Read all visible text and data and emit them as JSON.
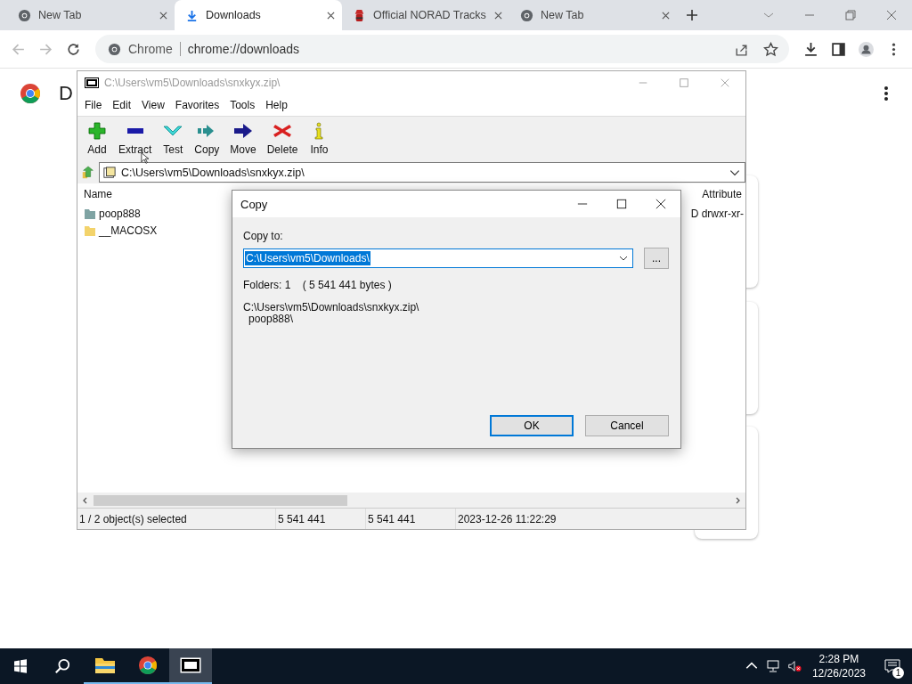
{
  "browser": {
    "tabs": [
      {
        "title": "New Tab",
        "kind": "chrome",
        "selected": false
      },
      {
        "title": "Downloads",
        "kind": "download",
        "selected": true
      },
      {
        "title": "Official NORAD Tracks",
        "kind": "figure",
        "selected": false
      },
      {
        "title": "New Tab",
        "kind": "chrome",
        "selected": false
      }
    ],
    "address": {
      "site": "Chrome",
      "url": "chrome://downloads"
    }
  },
  "page": {
    "heading": "D"
  },
  "archiver": {
    "title": "C:\\Users\\vm5\\Downloads\\snxkyx.zip\\",
    "menu": [
      "File",
      "Edit",
      "View",
      "Favorites",
      "Tools",
      "Help"
    ],
    "toolbar": [
      {
        "label": "Add",
        "kind": "add"
      },
      {
        "label": "Extract",
        "kind": "extract"
      },
      {
        "label": "Test",
        "kind": "test"
      },
      {
        "label": "Copy",
        "kind": "copy"
      },
      {
        "label": "Move",
        "kind": "move"
      },
      {
        "label": "Delete",
        "kind": "delete"
      },
      {
        "label": "Info",
        "kind": "info"
      }
    ],
    "path": "C:\\Users\\vm5\\Downloads\\snxkyx.zip\\",
    "columns": {
      "name": "Name",
      "attributes": "Attribute"
    },
    "rows": [
      {
        "name": "poop888",
        "color": "#7fa3a3",
        "attributes": "D drwxr-xr-"
      },
      {
        "name": "__MACOSX",
        "color": "#f3d36b"
      }
    ],
    "status": [
      "1 / 2 object(s) selected",
      "5 541 441",
      "5 541 441",
      "2023-12-26 11:22:29"
    ]
  },
  "dialog": {
    "title": "Copy",
    "label": "Copy to:",
    "value": "C:\\Users\\vm5\\Downloads\\",
    "value_selected": true,
    "browse": "...",
    "summary": "Folders: 1    ( 5 541 441 bytes )",
    "source": {
      "archive": "C:\\Users\\vm5\\Downloads\\snxkyx.zip\\",
      "children": [
        "poop888\\"
      ]
    },
    "buttons": [
      {
        "label": "OK",
        "default": true
      },
      {
        "label": "Cancel",
        "default": false
      }
    ]
  },
  "taskbar": {
    "apps": [
      {
        "kind": "explorer",
        "active": false
      },
      {
        "kind": "chrome",
        "active": false
      },
      {
        "kind": "sevenzip",
        "active": true
      }
    ],
    "time": "2:28 PM",
    "date": "12/26/2023",
    "notifications": "1"
  }
}
